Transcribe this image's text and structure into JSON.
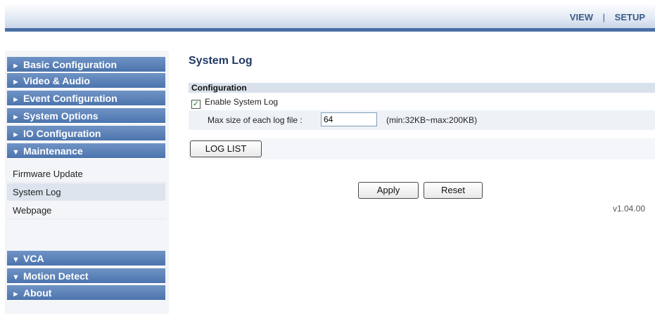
{
  "header": {
    "nav": {
      "view": "VIEW",
      "separator": "|",
      "setup": "SETUP"
    }
  },
  "sidebar": {
    "groups_top": [
      {
        "label": "Basic Configuration",
        "arrow": "►"
      },
      {
        "label": "Video & Audio",
        "arrow": "►"
      },
      {
        "label": "Event Configuration",
        "arrow": "►"
      },
      {
        "label": "System Options",
        "arrow": "►"
      },
      {
        "label": "IO Configuration",
        "arrow": "►"
      },
      {
        "label": "Maintenance",
        "arrow": "▼"
      }
    ],
    "maintenance_items": [
      {
        "label": "Firmware Update"
      },
      {
        "label": "System Log",
        "active": true
      },
      {
        "label": "Webpage"
      }
    ],
    "groups_bottom": [
      {
        "label": "VCA",
        "arrow": "▼"
      },
      {
        "label": "Motion Detect",
        "arrow": "▼"
      },
      {
        "label": "About",
        "arrow": "►"
      }
    ]
  },
  "main": {
    "title": "System Log",
    "section": "Configuration",
    "enable_label": "Enable System Log",
    "enable_checked": true,
    "check_glyph": "✓",
    "size_label": "Max size of each log file :",
    "size_value": "64",
    "size_hint": "(min:32KB~max:200KB)",
    "log_list_button": "LOG LIST",
    "apply_button": "Apply",
    "reset_button": "Reset",
    "version": "v1.04.00"
  },
  "colors": {
    "menu_header": "#4c74ad",
    "header_line": "#4a6fa5",
    "title": "#223b63"
  }
}
